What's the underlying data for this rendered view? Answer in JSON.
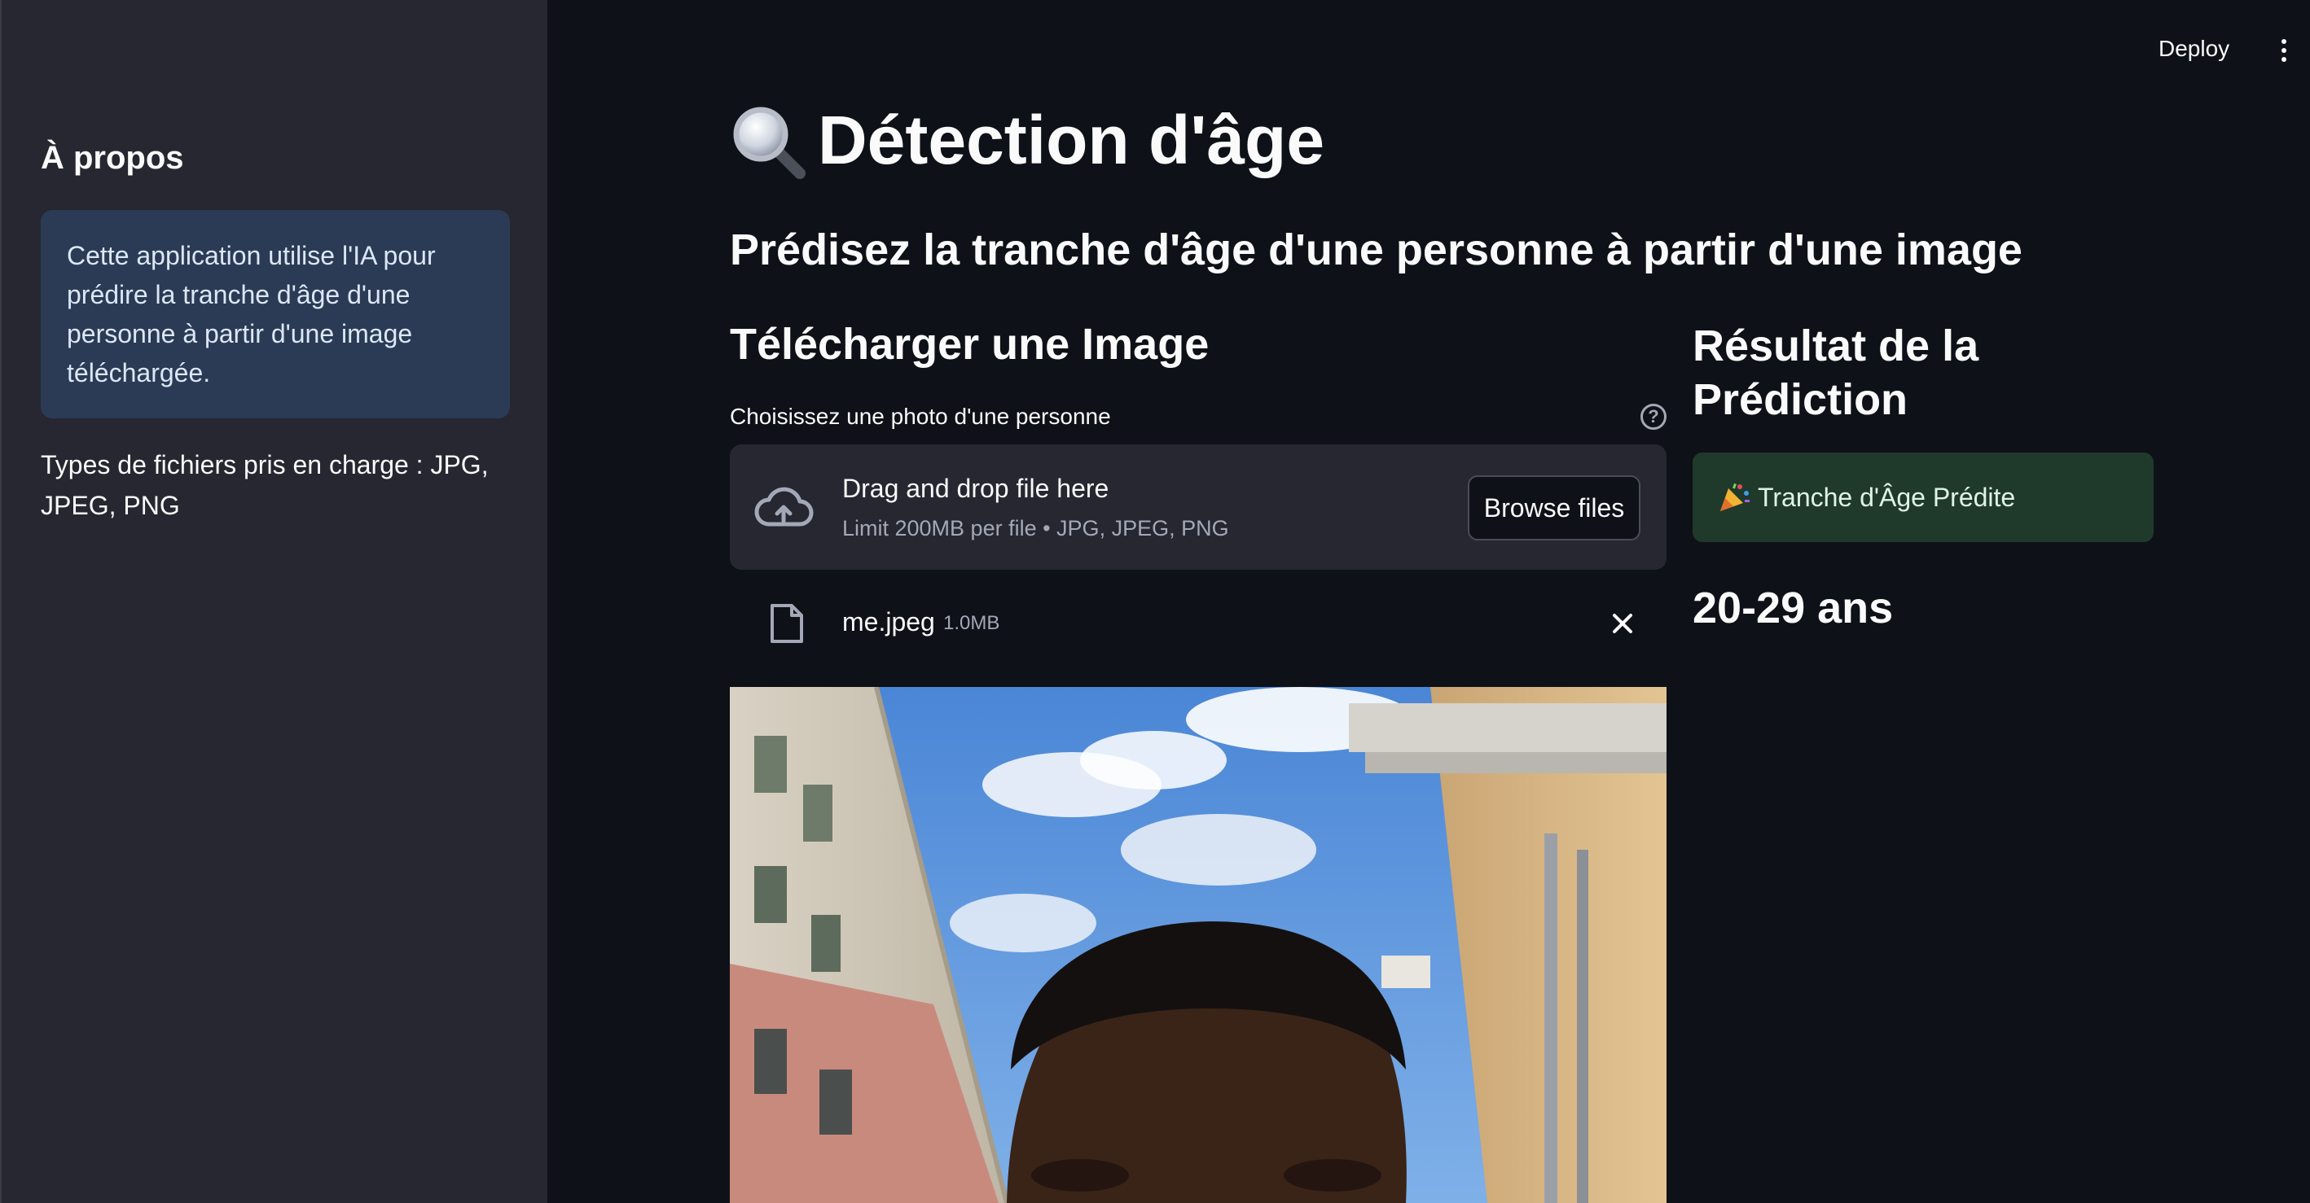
{
  "header": {
    "deploy_label": "Deploy"
  },
  "sidebar": {
    "heading": "À propos",
    "info": "Cette application utilise l'IA pour prédire la tranche d'âge d'une personne à partir d'une image téléchargée.",
    "file_types": "Types de fichiers pris en charge : JPG, JPEG, PNG"
  },
  "main": {
    "title": "Détection d'âge",
    "subtitle": "Prédisez la tranche d'âge d'une personne à partir d'une image",
    "upload": {
      "heading": "Télécharger une Image",
      "label": "Choisissez une photo d'une personne",
      "dropzone_title": "Drag and drop file here",
      "dropzone_limit": "Limit 200MB per file • JPG, JPEG, PNG",
      "browse_label": "Browse files",
      "file": {
        "name": "me.jpeg",
        "size": "1.0MB"
      }
    },
    "result": {
      "heading": "Résultat de la Prédiction",
      "success_label": "Tranche d'Âge Prédite",
      "value": "20-29 ans"
    }
  },
  "colors": {
    "background": "#0e1117",
    "sidebar": "#262730",
    "info_box": "#2b3b55",
    "success_box": "#1f3a2b"
  },
  "icons": [
    "magnifying-glass-icon",
    "help-icon",
    "cloud-upload-icon",
    "file-icon",
    "close-icon",
    "party-popper-icon",
    "kebab-menu-icon"
  ]
}
